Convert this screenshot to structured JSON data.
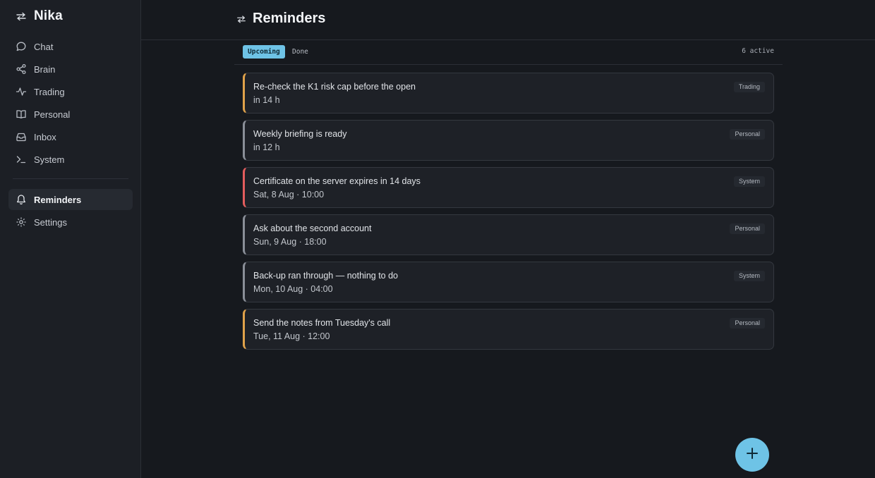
{
  "brand": {
    "name": "Nika"
  },
  "nav": {
    "items": [
      {
        "label": "Chat",
        "icon": "chat-bubble-icon"
      },
      {
        "label": "Brain",
        "icon": "share-nodes-icon"
      },
      {
        "label": "Trading",
        "icon": "activity-pulse-icon"
      },
      {
        "label": "Personal",
        "icon": "open-book-icon"
      },
      {
        "label": "Inbox",
        "icon": "inbox-tray-icon"
      },
      {
        "label": "System",
        "icon": "terminal-prompt-icon"
      }
    ],
    "secondary": [
      {
        "label": "Reminders",
        "icon": "bell-icon",
        "active": true
      },
      {
        "label": "Settings",
        "icon": "gear-icon"
      }
    ]
  },
  "header": {
    "title": "Reminders"
  },
  "tabs": {
    "upcoming": "Upcoming",
    "done": "Done",
    "count": "6 active"
  },
  "reminders": [
    {
      "text": "Re-check the K1 risk cap before the open",
      "when": "in 14 h",
      "tag": "Trading",
      "accent": "#e0a24a"
    },
    {
      "text": "Weekly briefing is ready",
      "when": "in 12 h",
      "tag": "Personal",
      "accent": "#8a8f98"
    },
    {
      "text": "Certificate on the server expires in 14 days",
      "when": "Sat, 8 Aug · 10:00",
      "tag": "System",
      "accent": "#e35d5d"
    },
    {
      "text": "Ask about the second account",
      "when": "Sun, 9 Aug · 18:00",
      "tag": "Personal",
      "accent": "#8a8f98"
    },
    {
      "text": "Back-up ran through — nothing to do",
      "when": "Mon, 10 Aug · 04:00",
      "tag": "System",
      "accent": "#8a8f98"
    },
    {
      "text": "Send the notes from Tuesday's call",
      "when": "Tue, 11 Aug · 12:00",
      "tag": "Personal",
      "accent": "#e0a24a"
    }
  ],
  "colors": {
    "accent": "#6ec3e6",
    "background": "#16191e",
    "sidebar": "#1c1f25"
  },
  "fab": {
    "icon": "plus-icon"
  }
}
